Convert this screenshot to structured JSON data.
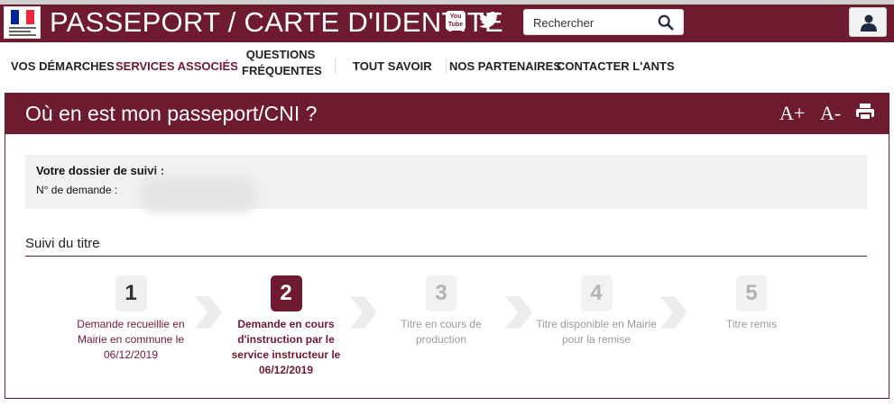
{
  "header": {
    "title": "PASSEPORT / CARTE D'IDENTITE",
    "logo_icon": "republique-francaise-logo",
    "youtube_label": "You Tube",
    "search_placeholder": "Rechercher",
    "brand_color": "#6e1a2f"
  },
  "nav": {
    "items": [
      {
        "label": "VOS DÉMARCHES"
      },
      {
        "label": "SERVICES ASSOCIÉS",
        "active": true
      },
      {
        "label": "QUESTIONS\nFRÉQUENTES"
      },
      {
        "label": "TOUT SAVOIR"
      },
      {
        "label": "NOS PARTENAIRES"
      },
      {
        "label": "CONTACTER L'ANTS"
      }
    ]
  },
  "panel": {
    "title": "Où en est mon passeport/CNI ?",
    "tools": {
      "font_increase": "A+",
      "font_decrease": "A-",
      "print_icon": "print-icon"
    }
  },
  "dossier": {
    "title": "Votre dossier de suivi :",
    "demande_label": "N° de demande : "
  },
  "suivi": {
    "title": "Suivi du titre",
    "steps": [
      {
        "number": "1",
        "label": "Demande recueillie en Mairie en commune le 06/12/2019",
        "state": "done"
      },
      {
        "number": "2",
        "label": "Demande en cours d'instruction par le service instructeur le 06/12/2019",
        "state": "current"
      },
      {
        "number": "3",
        "label": "Titre en cours de production",
        "state": "todo"
      },
      {
        "number": "4",
        "label": "Titre disponible en Mairie pour la remise",
        "state": "todo"
      },
      {
        "number": "5",
        "label": "Titre remis",
        "state": "todo"
      }
    ]
  }
}
